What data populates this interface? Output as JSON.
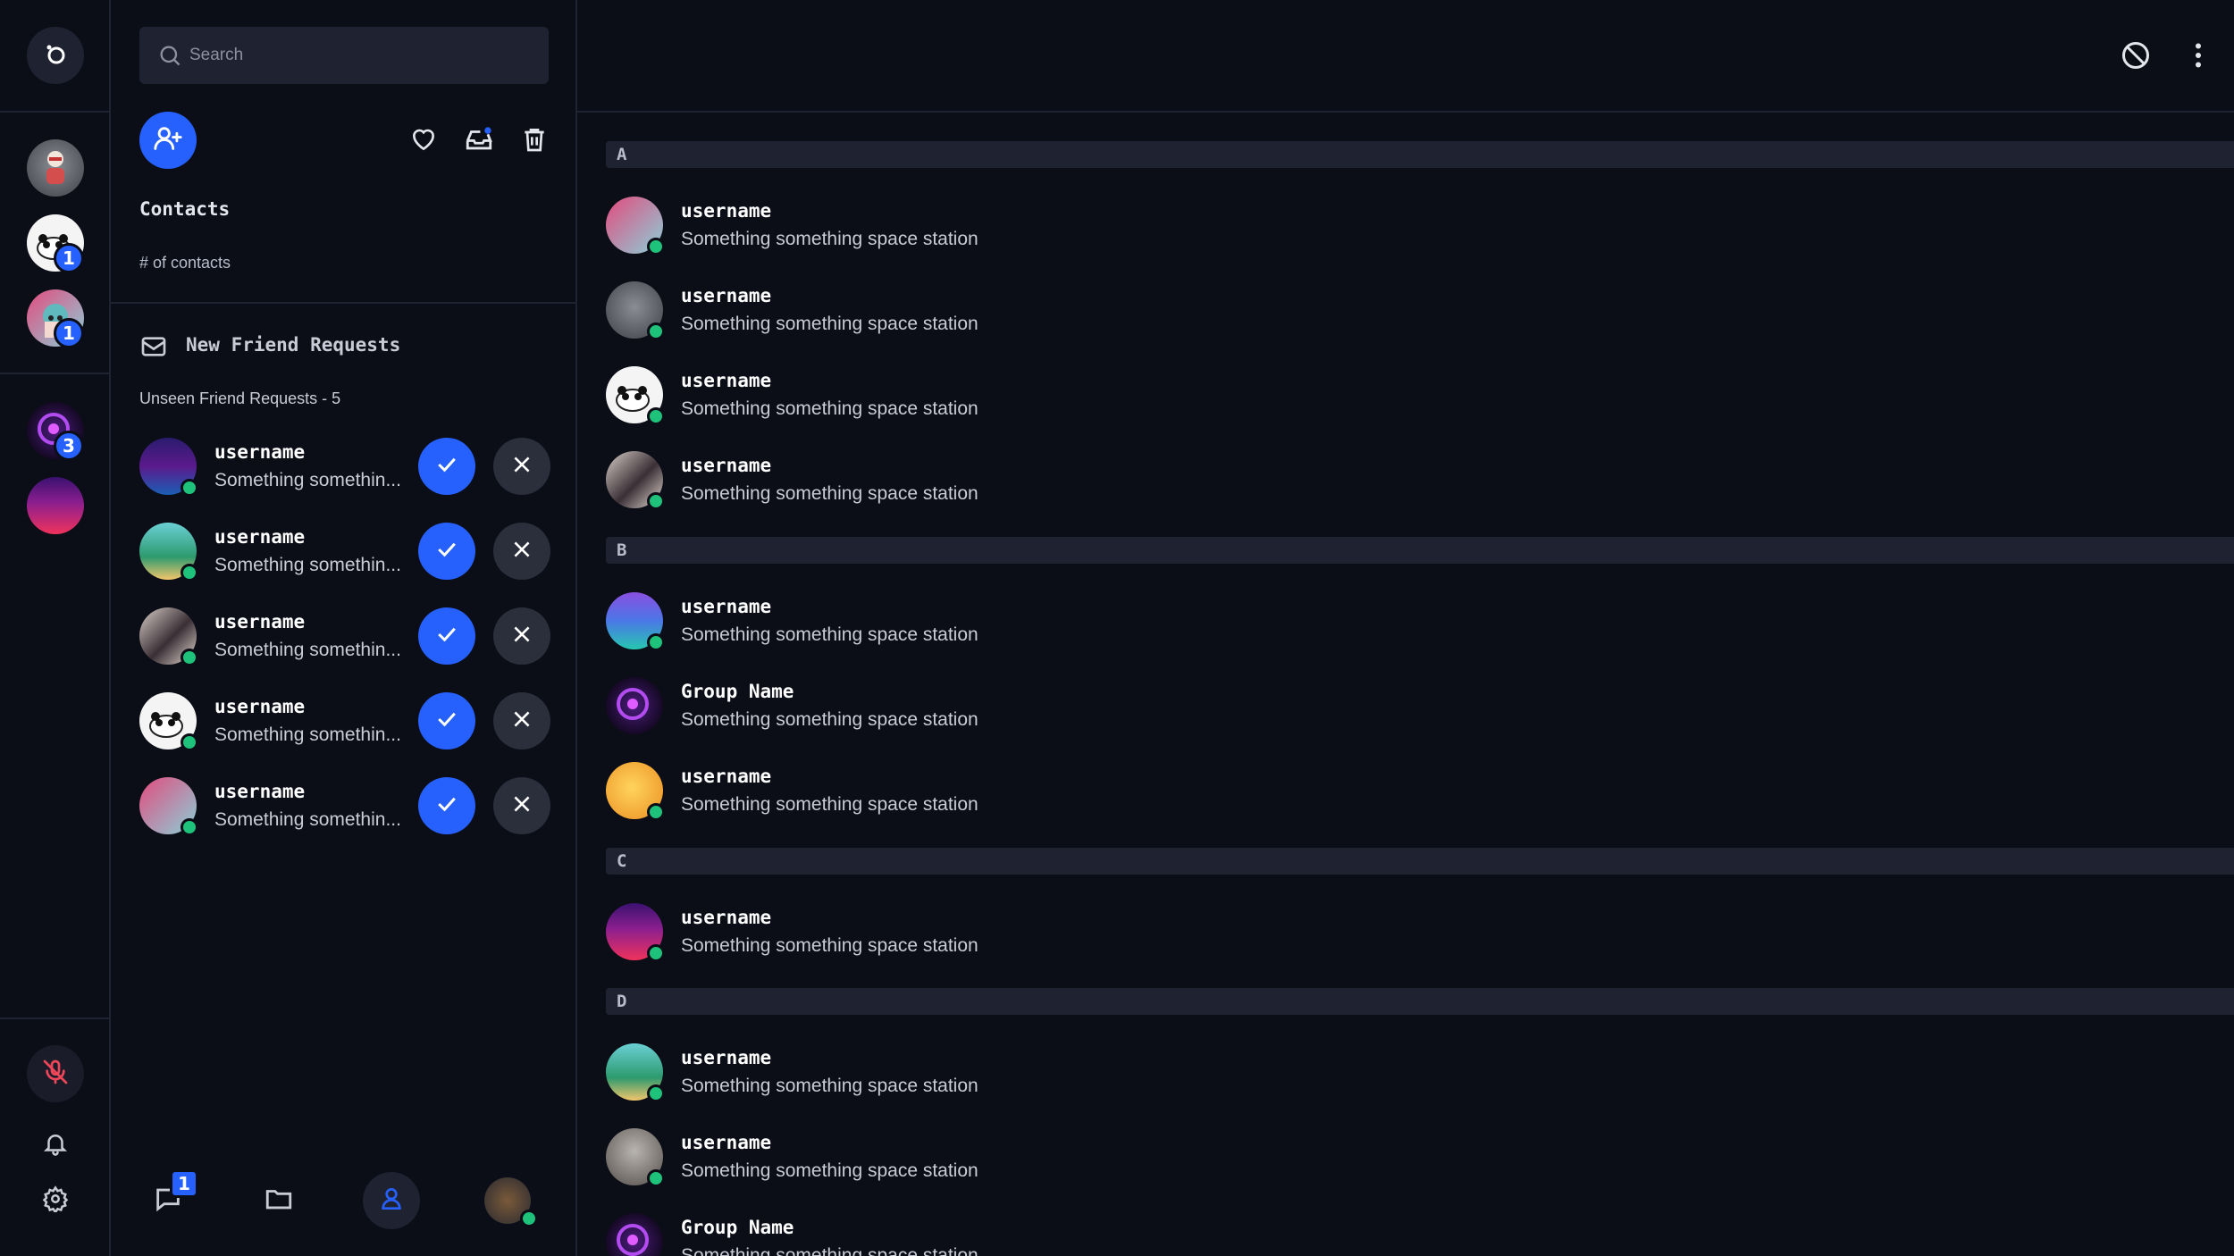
{
  "rail": {
    "home_logo": "logo-icon",
    "server_badges": [
      "1",
      "1",
      "3"
    ],
    "controls": [
      "mic-off-icon",
      "bell-icon",
      "gear-icon"
    ]
  },
  "sidebar": {
    "search_placeholder": "Search",
    "contacts_title": "Contacts",
    "contacts_count": "# of contacts",
    "friend_requests_title": "New Friend Requests",
    "unseen_label": "Unseen Friend Requests - 5",
    "requests": [
      {
        "name": "username",
        "status": "Something somethin..."
      },
      {
        "name": "username",
        "status": "Something somethin..."
      },
      {
        "name": "username",
        "status": "Something somethin..."
      },
      {
        "name": "username",
        "status": "Something somethin..."
      },
      {
        "name": "username",
        "status": "Something somethin..."
      }
    ],
    "bottom_nav": {
      "chat_badge": "1"
    }
  },
  "main": {
    "sections": [
      {
        "letter": "A",
        "contacts": [
          {
            "name": "username",
            "status": "Something something space station"
          },
          {
            "name": "username",
            "status": "Something something space station"
          },
          {
            "name": "username",
            "status": "Something something space station"
          },
          {
            "name": "username",
            "status": "Something something space station"
          }
        ]
      },
      {
        "letter": "B",
        "contacts": [
          {
            "name": "username",
            "status": "Something something space station"
          },
          {
            "name": "Group Name",
            "status": "Something something space station"
          },
          {
            "name": "username",
            "status": "Something something space station"
          }
        ]
      },
      {
        "letter": "C",
        "contacts": [
          {
            "name": "username",
            "status": "Something something space station"
          }
        ]
      },
      {
        "letter": "D",
        "contacts": [
          {
            "name": "username",
            "status": "Something something space station"
          },
          {
            "name": "username",
            "status": "Something something space station"
          },
          {
            "name": "Group Name",
            "status": "Something something space station"
          }
        ]
      }
    ]
  },
  "colors": {
    "background": "#0b0d17",
    "panel": "#1f2230",
    "accent": "#2761fd",
    "online": "#1fc27b",
    "danger": "#f0465a"
  }
}
